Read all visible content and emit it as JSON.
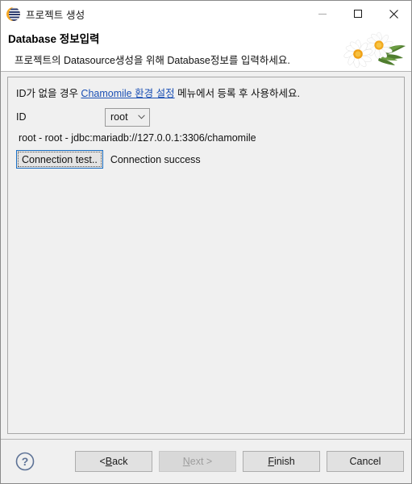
{
  "titlebar": {
    "icon": "eclipse-logo-icon",
    "title": "프로젝트 생성",
    "minimize_label": "minimize-icon",
    "maximize_label": "maximize-icon",
    "close_label": "close-icon"
  },
  "header": {
    "title_bold": "Database",
    "title_rest": " 정보입력",
    "subtitle": "프로젝트의 Datasource생성을 위해 Database정보를 입력하세요.",
    "artwork": "chamomile-flowers-image"
  },
  "content": {
    "hint_before": "ID가 없을 경우 ",
    "hint_link": "Chamomile 환경 설정",
    "hint_after": " 메뉴에서 등록 후 사용하세요.",
    "id_label": "ID",
    "id_value": "root",
    "id_options": [
      "root"
    ],
    "connection_string": "root - root - jdbc:mariadb://127.0.0.1:3306/chamomile",
    "test_button": "Connection test..",
    "test_status": "Connection success"
  },
  "buttonbar": {
    "help": "?",
    "back_prefix": "< ",
    "back_mnemonic": "B",
    "back_suffix": "ack",
    "next_mnemonic": "N",
    "next_suffix": "ext >",
    "finish_mnemonic": "F",
    "finish_suffix": "inish",
    "cancel": "Cancel"
  },
  "colors": {
    "link": "#1a4fb4",
    "focus_border": "#1a6fc4",
    "panel_bg": "#f0f0f0",
    "icon_navy": "#2c3b6e",
    "icon_orange": "#f5a623"
  }
}
